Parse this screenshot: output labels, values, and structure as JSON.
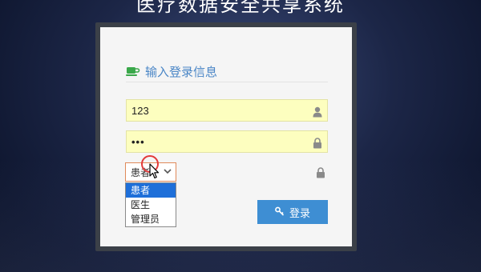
{
  "page": {
    "title": "医疗数据安全共享系统"
  },
  "login": {
    "heading": "输入登录信息",
    "username_value": "123",
    "password_value": "•••",
    "role": {
      "selected": "患者",
      "options": [
        "患者",
        "医生",
        "管理员"
      ]
    },
    "button_label": "登录"
  },
  "colors": {
    "heading_blue": "#4a86c6",
    "field_yellow": "#fdfebf",
    "button_blue": "#3e8ed3",
    "option_highlight": "#1e6fd9",
    "cursor_ring": "#e23a3a"
  },
  "icons": {
    "heading": "cup-icon",
    "username": "user-icon",
    "password": "lock-icon",
    "role": "lock-icon",
    "button": "key-icon"
  }
}
